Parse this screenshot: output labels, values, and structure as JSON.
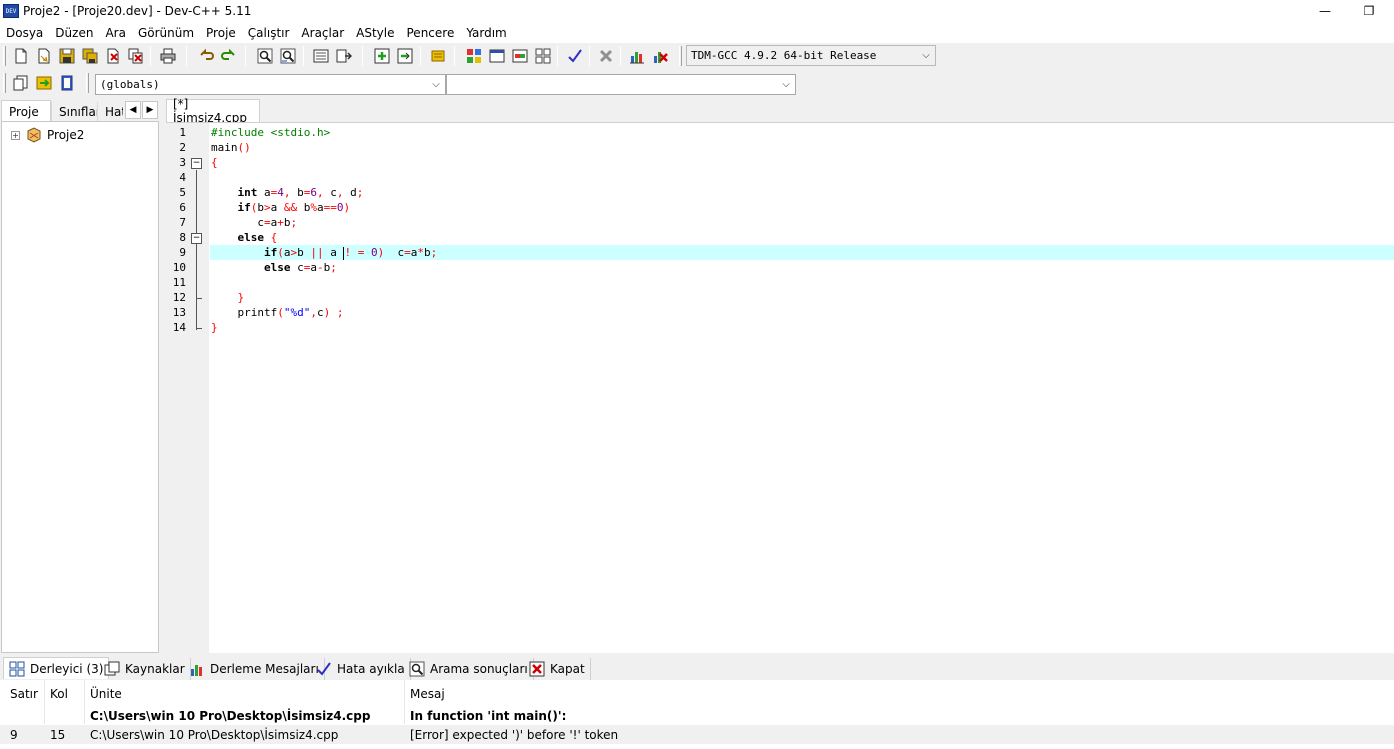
{
  "window": {
    "icon_text": "DEV",
    "title": "Proje2 - [Proje20.dev] - Dev-C++ 5.11",
    "minimize": "—",
    "maximize": "❐"
  },
  "menu": [
    "Dosya",
    "Düzen",
    "Ara",
    "Görünüm",
    "Proje",
    "Çalıştır",
    "Araçlar",
    "AStyle",
    "Pencere",
    "Yardım"
  ],
  "toolbar": {
    "compiler": "TDM-GCC 4.9.2 64-bit Release",
    "scope": "(globals)",
    "symbol": ""
  },
  "left_panel": {
    "tabs": [
      "Proje",
      "Sınıflar",
      "Hat"
    ],
    "tree": {
      "project": "Proje2",
      "expander": "+"
    }
  },
  "editor": {
    "tab": "[*] İsimsiz4.cpp",
    "line_numbers": [
      "1",
      "2",
      "3",
      "4",
      "5",
      "6",
      "7",
      "8",
      "9",
      "10",
      "11",
      "12",
      "13",
      "14"
    ],
    "current_line": 9
  },
  "bottom_panel": {
    "tabs": [
      "Derleyici (3)",
      "Kaynaklar",
      "Derleme Mesajları",
      "Hata ayıkla",
      "Arama sonuçları",
      "Kapat"
    ],
    "columns": [
      "Satır",
      "Kol",
      "Ünite",
      "Mesaj"
    ],
    "rows": [
      {
        "line": "",
        "col": "",
        "unit": "C:\\Users\\win 10 Pro\\Desktop\\İsimsiz4.cpp",
        "message": "In function 'int main()':"
      },
      {
        "line": "9",
        "col": "15",
        "unit": "C:\\Users\\win 10 Pro\\Desktop\\İsimsiz4.cpp",
        "message": "[Error] expected ')' before '!' token"
      }
    ]
  },
  "colors": {
    "current_line": "#ccffff",
    "preprocessor": "#008000",
    "number": "#800080",
    "symbol": "#ff0000",
    "string": "#0000ff"
  }
}
